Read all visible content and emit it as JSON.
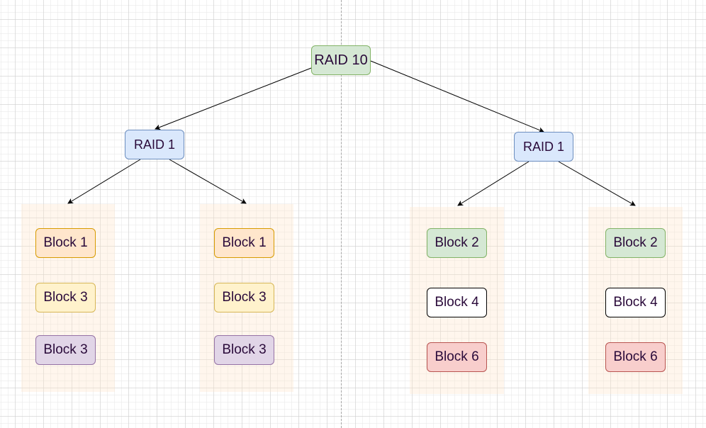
{
  "diagram": {
    "root": {
      "label": "RAID 10",
      "fill": "#d5e8d4",
      "stroke": "#82b366"
    },
    "mirrors": [
      {
        "label": "RAID 1",
        "fill": "#dae8fc",
        "stroke": "#6c8ebf",
        "disks": [
          {
            "blocks": [
              {
                "label": "Block 1",
                "fill": "#ffe6cc",
                "stroke": "#d79b00"
              },
              {
                "label": "Block 3",
                "fill": "#fff2cc",
                "stroke": "#d6b656"
              },
              {
                "label": "Block 3",
                "fill": "#e1d5e7",
                "stroke": "#9673a6"
              }
            ]
          },
          {
            "blocks": [
              {
                "label": "Block 1",
                "fill": "#ffe6cc",
                "stroke": "#d79b00"
              },
              {
                "label": "Block 3",
                "fill": "#fff2cc",
                "stroke": "#d6b656"
              },
              {
                "label": "Block 3",
                "fill": "#e1d5e7",
                "stroke": "#9673a6"
              }
            ]
          }
        ]
      },
      {
        "label": "RAID 1",
        "fill": "#dae8fc",
        "stroke": "#6c8ebf",
        "disks": [
          {
            "blocks": [
              {
                "label": "Block 2",
                "fill": "#d5e8d4",
                "stroke": "#82b366"
              },
              {
                "label": "Block 4",
                "fill": "#ffffff",
                "stroke": "#000000"
              },
              {
                "label": "Block 6",
                "fill": "#f8cecc",
                "stroke": "#b85450"
              }
            ]
          },
          {
            "blocks": [
              {
                "label": "Block 2",
                "fill": "#d5e8d4",
                "stroke": "#82b366"
              },
              {
                "label": "Block 4",
                "fill": "#ffffff",
                "stroke": "#000000"
              },
              {
                "label": "Block 6",
                "fill": "#f8cecc",
                "stroke": "#b85450"
              }
            ]
          }
        ]
      }
    ],
    "group_fill": "#ffe6cc",
    "edge_color": "#000000"
  }
}
